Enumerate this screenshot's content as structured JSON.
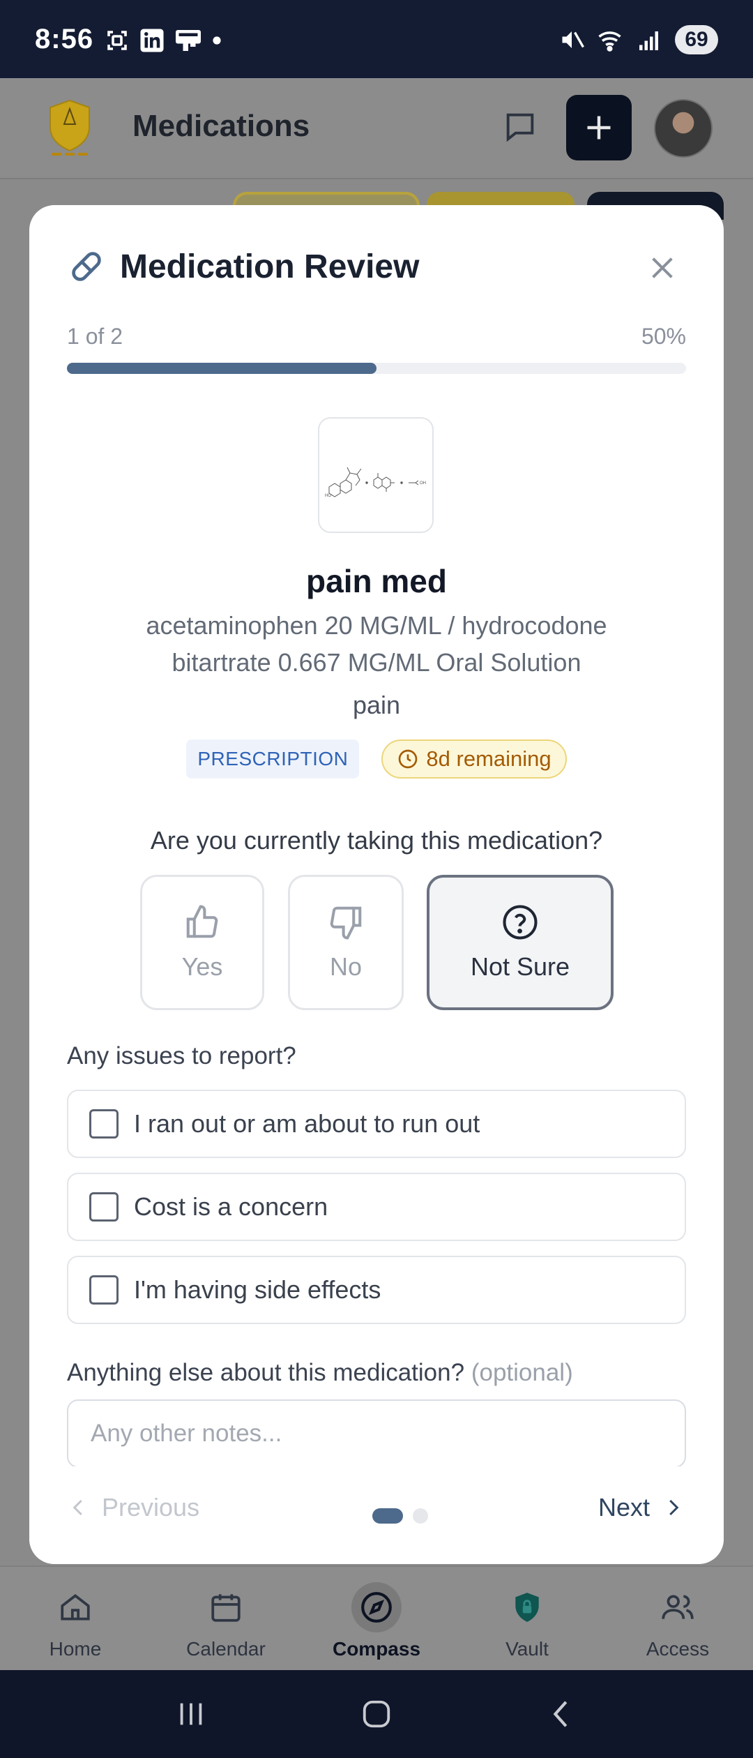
{
  "status_bar": {
    "time": "8:56",
    "battery": "69"
  },
  "app_header": {
    "title": "Medications"
  },
  "modal": {
    "title": "Medication Review",
    "progress": {
      "label": "1 of 2",
      "percent_text": "50%",
      "fraction": 0.5
    },
    "medication": {
      "name": "pain med",
      "description": "acetaminophen 20 MG/ML / hydrocodone bitartrate 0.667 MG/ML Oral Solution",
      "reason": "pain",
      "type_badge": "PRESCRIPTION",
      "remaining_badge": "8d remaining"
    },
    "question": "Are you currently taking this medication?",
    "answers": [
      {
        "label": "Yes",
        "icon": "thumbs-up-icon",
        "selected": false
      },
      {
        "label": "No",
        "icon": "thumbs-down-icon",
        "selected": false
      },
      {
        "label": "Not Sure",
        "icon": "question-circle-icon",
        "selected": true
      }
    ],
    "issues_label": "Any issues to report?",
    "issues": [
      {
        "label": "I ran out or am about to run out",
        "checked": false
      },
      {
        "label": "Cost is a concern",
        "checked": false
      },
      {
        "label": "I'm having side effects",
        "checked": false
      }
    ],
    "notes": {
      "label": "Anything else about this medication?",
      "optional": "(optional)",
      "placeholder": "Any other notes..."
    },
    "footer": {
      "previous": "Previous",
      "next": "Next",
      "page_count": 2,
      "current_page": 1
    }
  },
  "bottom_nav": [
    {
      "label": "Home",
      "icon": "home-icon",
      "active": false
    },
    {
      "label": "Calendar",
      "icon": "calendar-icon",
      "active": false
    },
    {
      "label": "Compass",
      "icon": "compass-icon",
      "active": true
    },
    {
      "label": "Vault",
      "icon": "lock-shield-icon",
      "active": false
    },
    {
      "label": "Access",
      "icon": "users-icon",
      "active": false
    }
  ],
  "colors": {
    "accent": "#4d6a8c",
    "badge_blue": "#2f63b8",
    "badge_amber": "#a35b05",
    "status_bar": "#141c33"
  }
}
